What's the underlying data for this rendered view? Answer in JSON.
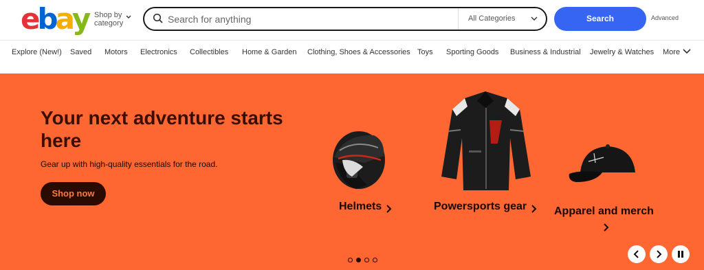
{
  "header": {
    "logo_letters": [
      "e",
      "b",
      "a",
      "y"
    ],
    "logo_colors": [
      "#e53238",
      "#0064d2",
      "#f5af02",
      "#86b817"
    ],
    "shop_by_line1": "Shop by",
    "shop_by_line2": "category",
    "search_placeholder": "Search for anything",
    "category_selected": "All Categories",
    "search_button": "Search",
    "advanced": "Advanced"
  },
  "nav": {
    "items": [
      "Explore (New!)",
      "Saved",
      "Motors",
      "Electronics",
      "Collectibles",
      "Home & Garden",
      "Clothing, Shoes & Accessories",
      "Toys",
      "Sporting Goods",
      "Business & Industrial",
      "Jewelry & Watches",
      "More"
    ]
  },
  "hero": {
    "title": "Your next adventure starts here",
    "subtitle": "Gear up with high-quality essentials for the road.",
    "cta": "Shop now",
    "tiles": [
      {
        "label": "Helmets",
        "icon": "helmet-image"
      },
      {
        "label": "Powersports gear",
        "icon": "jacket-image"
      },
      {
        "label": "Apparel and merch",
        "icon": "cap-image"
      }
    ],
    "carousel": {
      "slide_count": 4,
      "active_index": 1
    },
    "colors": {
      "background": "#fe6632",
      "dark": "#2b0a00"
    }
  }
}
